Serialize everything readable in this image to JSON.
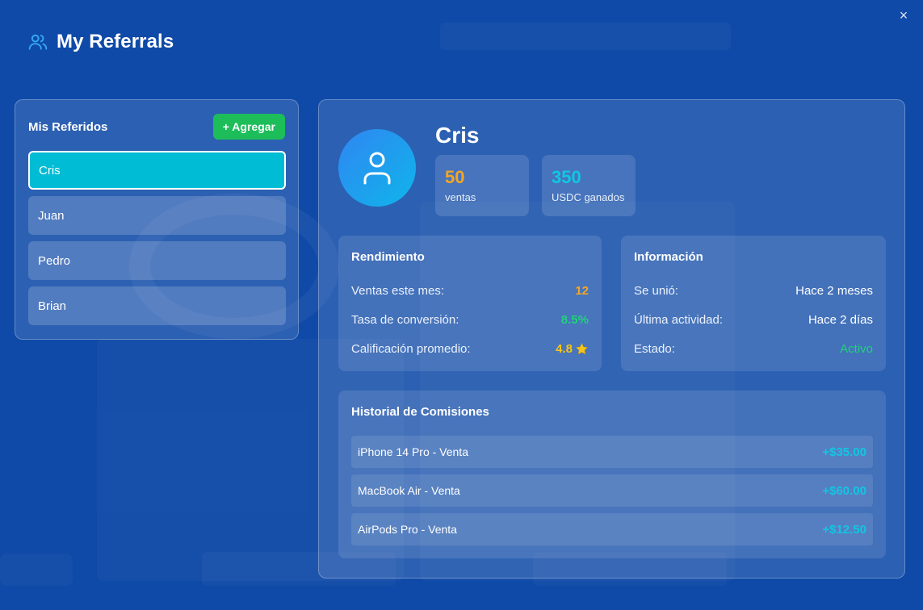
{
  "window": {
    "title": "My Referrals",
    "close_symbol": "×"
  },
  "referrals_panel": {
    "title": "Mis Referidos",
    "add_button": "+ Agregar",
    "items": [
      {
        "label": "Cris"
      },
      {
        "label": "Juan"
      },
      {
        "label": "Pedro"
      },
      {
        "label": "Brian"
      }
    ]
  },
  "profile": {
    "name": "Cris",
    "stats": [
      {
        "value": "50",
        "label": "ventas",
        "color": "#f5a623"
      },
      {
        "value": "350",
        "label": "USDC ganados",
        "color": "#12c6e3"
      }
    ]
  },
  "performance": {
    "title": "Rendimiento",
    "rows": [
      {
        "key": "Ventas este mes:",
        "value": "12",
        "color": "#f5a623"
      },
      {
        "key": "Tasa de conversión:",
        "value": "8.5%",
        "color": "#20d27a"
      },
      {
        "key": "Calificación promedio:",
        "value": "4.8",
        "color": "#f5c518"
      }
    ]
  },
  "info": {
    "title": "Información",
    "rows": [
      {
        "key": "Se unió:",
        "value": "Hace 2 meses"
      },
      {
        "key": "Última actividad:",
        "value": "Hace 2 días"
      },
      {
        "key": "Estado:",
        "value": "Activo",
        "color": "#20d27a"
      }
    ]
  },
  "commissions": {
    "title": "Historial de Comisiones",
    "rows": [
      {
        "item": "iPhone 14 Pro - Venta",
        "amount": "+$35.00"
      },
      {
        "item": "MacBook Air - Venta",
        "amount": "+$60.00"
      },
      {
        "item": "AirPods Pro - Venta",
        "amount": "+$12.50"
      }
    ]
  },
  "colors": {
    "background": "#0f4aa8",
    "accent": "#00bcd4",
    "add_button": "#1dbd5a",
    "amount": "#12c6e3"
  },
  "icons": [
    "users-icon",
    "close-icon",
    "user-avatar-icon",
    "star-icon"
  ]
}
